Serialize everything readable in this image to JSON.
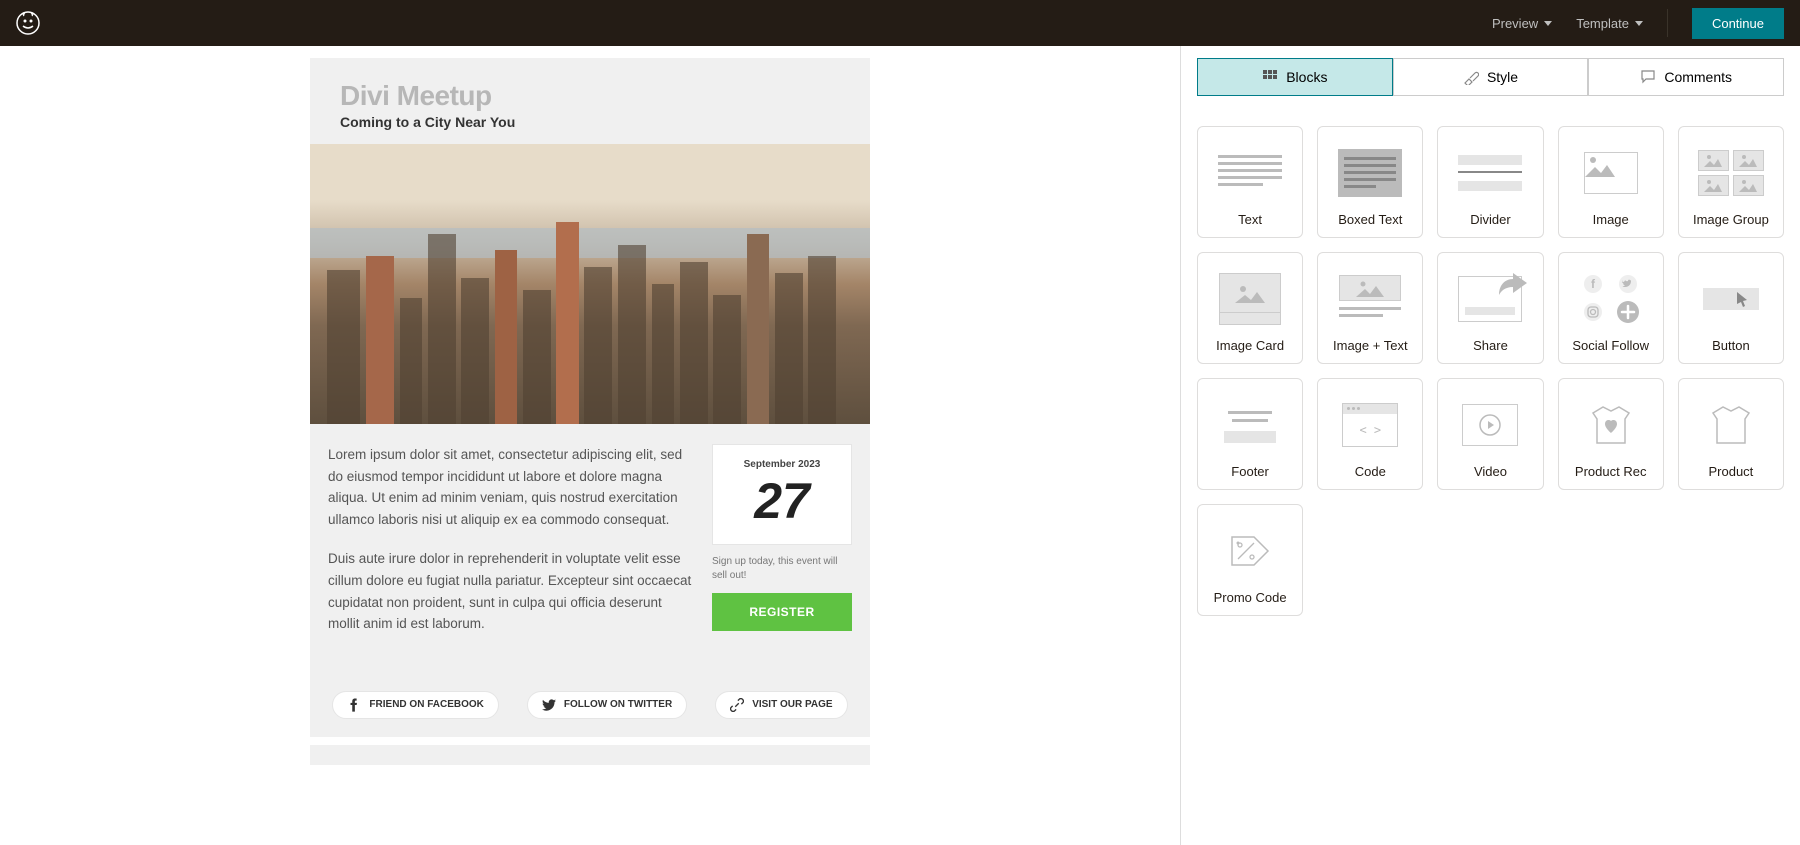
{
  "topbar": {
    "preview": "Preview",
    "template": "Template",
    "continue": "Continue"
  },
  "email": {
    "title": "Divi Meetup",
    "subtitle": "Coming to a City Near You",
    "body_p1": "Lorem ipsum dolor sit amet, consectetur adipiscing elit, sed do eiusmod tempor incididunt ut labore et dolore magna aliqua. Ut enim ad minim veniam, quis nostrud exercitation ullamco laboris nisi ut aliquip ex ea commodo consequat.",
    "body_p2": "Duis aute irure dolor in reprehenderit in voluptate velit esse cillum dolore eu fugiat nulla pariatur. Excepteur sint occaecat cupidatat non proident, sunt in culpa qui officia deserunt mollit anim id est laborum.",
    "date_month": "September 2023",
    "date_day": "27",
    "signup_text": "Sign up today, this event will sell out!",
    "register": "REGISTER",
    "social_fb": "FRIEND ON FACEBOOK",
    "social_tw": "FOLLOW ON TWITTER",
    "social_page": "VISIT OUR PAGE"
  },
  "tabs": {
    "blocks": "Blocks",
    "style": "Style",
    "comments": "Comments"
  },
  "blocks": [
    "Text",
    "Boxed Text",
    "Divider",
    "Image",
    "Image Group",
    "Image Card",
    "Image + Text",
    "Share",
    "Social Follow",
    "Button",
    "Footer",
    "Code",
    "Video",
    "Product Rec",
    "Product",
    "Promo Code"
  ]
}
